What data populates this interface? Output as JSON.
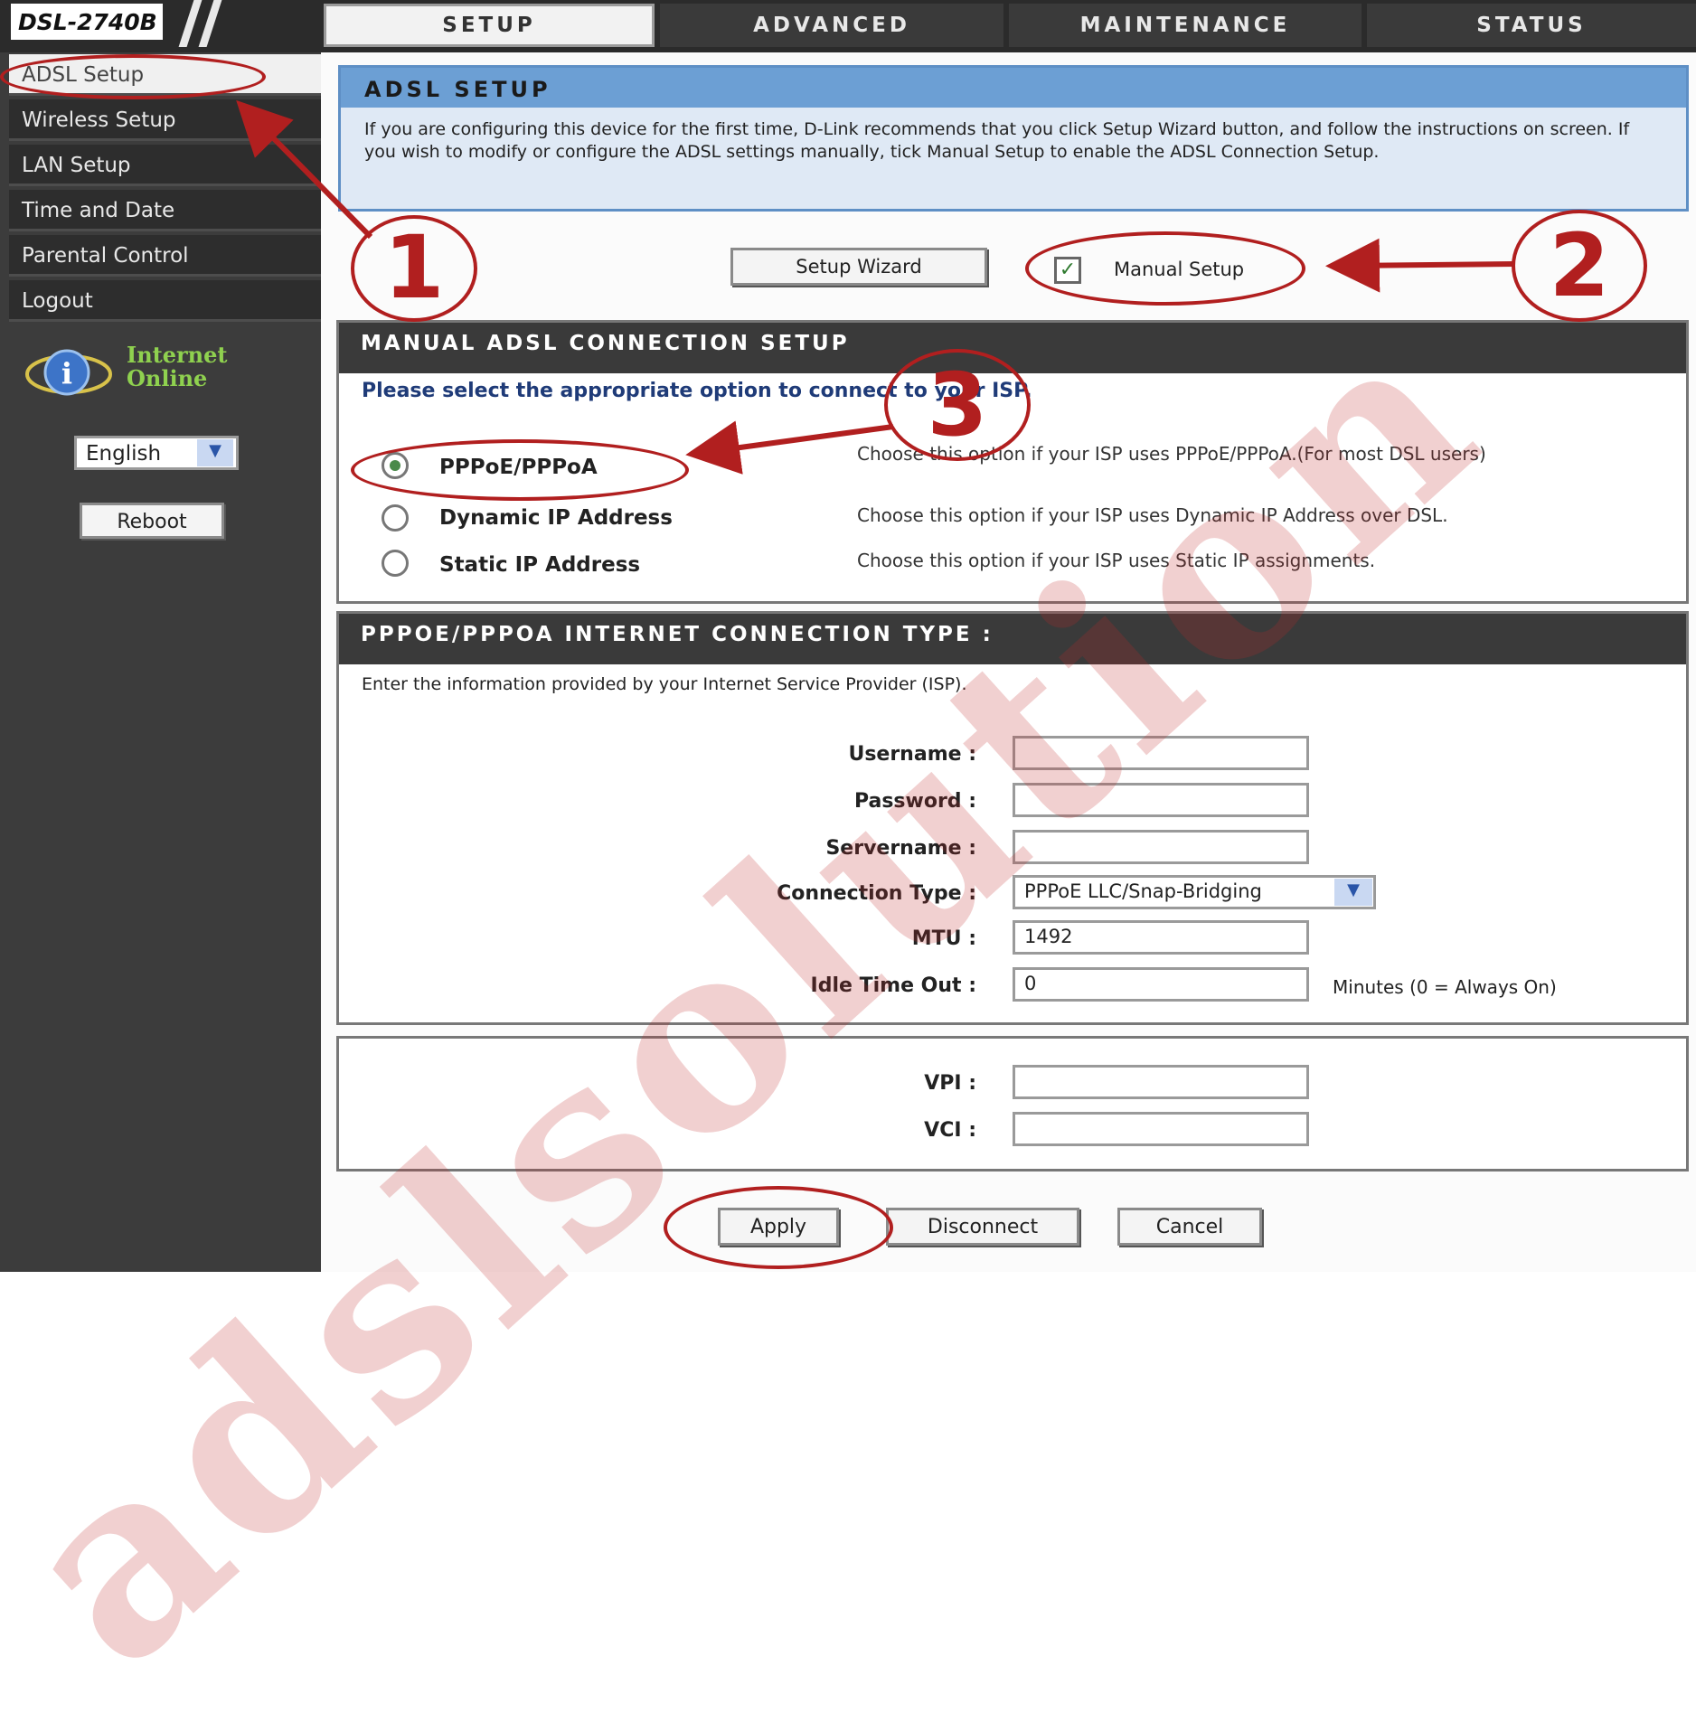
{
  "header": {
    "model": "DSL-2740B",
    "tabs": [
      {
        "label": "SETUP",
        "active": true
      },
      {
        "label": "ADVANCED",
        "active": false
      },
      {
        "label": "MAINTENANCE",
        "active": false
      },
      {
        "label": "STATUS",
        "active": false
      }
    ]
  },
  "sidebar": {
    "items": [
      {
        "label": "ADSL Setup",
        "active": true
      },
      {
        "label": "Wireless Setup"
      },
      {
        "label": "LAN Setup"
      },
      {
        "label": "Time and Date"
      },
      {
        "label": "Parental Control"
      },
      {
        "label": "Logout"
      }
    ],
    "status": {
      "line1": "Internet",
      "line2": "Online",
      "icon": "info-icon"
    },
    "language": {
      "selected": "English"
    },
    "reboot_label": "Reboot"
  },
  "adsl_setup": {
    "title": "ADSL SETUP",
    "description": "If you are configuring this device for the first time, D-Link recommends that you click Setup Wizard button, and follow the instructions on screen. If you wish to modify or configure the ADSL settings manually, tick Manual Setup to enable the ADSL Connection Setup.",
    "wizard_label": "Setup Wizard",
    "manual_label": "Manual Setup",
    "manual_checked": true
  },
  "manual_connection": {
    "title": "MANUAL ADSL CONNECTION SETUP",
    "prompt": "Please select the appropriate option to connect to your ISP.",
    "options": [
      {
        "label": "PPPoE/PPPoA",
        "desc": "Choose this option if your ISP uses PPPoE/PPPoA.(For most DSL users)",
        "selected": true
      },
      {
        "label": "Dynamic IP Address",
        "desc": "Choose this option if your ISP uses Dynamic IP Address over DSL.",
        "selected": false
      },
      {
        "label": "Static IP Address",
        "desc": "Choose this option if your ISP uses Static IP assignments.",
        "selected": false
      }
    ]
  },
  "pppoe": {
    "title": "PPPOE/PPPOA INTERNET CONNECTION TYPE :",
    "intro": "Enter the information provided by your Internet Service Provider (ISP).",
    "username_label": "Username :",
    "username_value": "",
    "password_label": "Password :",
    "password_value": "",
    "servername_label": "Servername :",
    "servername_value": "",
    "connection_type_label": "Connection Type :",
    "connection_type_value": "PPPoE LLC/Snap-Bridging",
    "mtu_label": "MTU :",
    "mtu_value": "1492",
    "idle_label": "Idle Time Out :",
    "idle_value": "0",
    "idle_hint": "Minutes (0 = Always On)"
  },
  "vpi_vci": {
    "vpi_label": "VPI :",
    "vpi_value": "",
    "vci_label": "VCI :",
    "vci_value": ""
  },
  "actions": {
    "apply": "Apply",
    "disconnect": "Disconnect",
    "cancel": "Cancel"
  },
  "annotations": {
    "step1": "1",
    "step2": "2",
    "step3": "3",
    "color": "#b11f1f"
  },
  "watermark": "adslsolution"
}
